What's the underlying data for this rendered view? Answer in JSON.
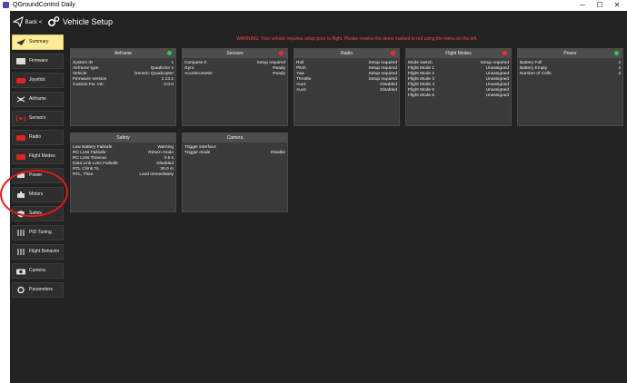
{
  "titlebar": {
    "title": "QGroundControl Daily",
    "minimize": "─",
    "maximize": "☐",
    "close": "✕"
  },
  "toolbar": {
    "back_label": "Back",
    "back_chevron": "<",
    "title": "Vehicle Setup"
  },
  "warning": "WARNING: Your vehicle requires setup prior to flight. Please resolve the items marked in red using the menu on the left.",
  "colors": {
    "active_bg": "#ffec99",
    "ok_dot": "#2ecc40",
    "error_dot": "#ff2a2a",
    "warning_text": "#ff4444",
    "annotation": "#e01919"
  },
  "sidebar": {
    "items": [
      {
        "label": "Summary",
        "icon": "paper-plane-icon"
      },
      {
        "label": "Firmware",
        "icon": "firmware-chip-icon"
      },
      {
        "label": "Joystick",
        "icon": "joystick-icon"
      },
      {
        "label": "Airframe",
        "icon": "airframe-icon"
      },
      {
        "label": "Sensors",
        "icon": "sensors-icon"
      },
      {
        "label": "Radio",
        "icon": "radio-icon"
      },
      {
        "label": "Flight Modes",
        "icon": "flight-modes-icon"
      },
      {
        "label": "Power",
        "icon": "power-icon"
      },
      {
        "label": "Motors",
        "icon": "motors-icon"
      },
      {
        "label": "Safety",
        "icon": "safety-icon"
      },
      {
        "label": "PID Tuning",
        "icon": "pid-tuning-icon"
      },
      {
        "label": "Flight Behavior",
        "icon": "flight-behavior-icon"
      },
      {
        "label": "Camera",
        "icon": "camera-icon"
      },
      {
        "label": "Parameters",
        "icon": "parameters-icon"
      }
    ]
  },
  "cards": {
    "airframe": {
      "title": "Airframe",
      "status": "ok",
      "rows": [
        {
          "k": "System ID",
          "v": "1"
        },
        {
          "k": "Airframe type",
          "v": "Quadrotor x"
        },
        {
          "k": "Vehicle",
          "v": "Generic Quadcopter"
        },
        {
          "k": "Firmware Version",
          "v": "1.13.1"
        },
        {
          "k": "Custom Fw. Ver.",
          "v": "0.0.0"
        }
      ]
    },
    "sensors": {
      "title": "Sensors",
      "status": "error",
      "rows": [
        {
          "k": "Compass 0",
          "v": "Setup required"
        },
        {
          "k": "Gyro",
          "v": "Ready"
        },
        {
          "k": "Accelerometer",
          "v": "Ready"
        }
      ]
    },
    "radio": {
      "title": "Radio",
      "status": "error",
      "rows": [
        {
          "k": "Roll",
          "v": "Setup required"
        },
        {
          "k": "Pitch",
          "v": "Setup required"
        },
        {
          "k": "Yaw",
          "v": "Setup required"
        },
        {
          "k": "Throttle",
          "v": "Setup required"
        },
        {
          "k": "Aux1",
          "v": "Disabled"
        },
        {
          "k": "Aux2",
          "v": "Disabled"
        }
      ]
    },
    "flightmodes": {
      "title": "Flight Modes",
      "status": "error",
      "rows": [
        {
          "k": "Mode switch",
          "v": "Setup required"
        },
        {
          "k": "Flight Mode 1",
          "v": "Unassigned"
        },
        {
          "k": "Flight Mode 2",
          "v": "Unassigned"
        },
        {
          "k": "Flight Mode 3",
          "v": "Unassigned"
        },
        {
          "k": "Flight Mode 4",
          "v": "Unassigned"
        },
        {
          "k": "Flight Mode 5",
          "v": "Unassigned"
        },
        {
          "k": "Flight Mode 6",
          "v": "Unassigned"
        }
      ]
    },
    "power": {
      "title": "Power",
      "status": "ok",
      "rows": [
        {
          "k": "Battery Full",
          "v": "4"
        },
        {
          "k": "Battery Empty",
          "v": "4"
        },
        {
          "k": "Number of Cells",
          "v": "3"
        }
      ]
    },
    "safety": {
      "title": "Safety",
      "status": "none",
      "rows": [
        {
          "k": "Low Battery Failsafe",
          "v": "Warning"
        },
        {
          "k": "RC Loss Failsafe",
          "v": "Return mode"
        },
        {
          "k": "RC Loss Timeout",
          "v": "0.5 s"
        },
        {
          "k": "Data Link Loss Failsafe",
          "v": "Disabled"
        },
        {
          "k": "RTL Climb To",
          "v": "30.0 m"
        },
        {
          "k": "RTL, Then",
          "v": "Land immediately"
        }
      ]
    },
    "camera": {
      "title": "Camera",
      "status": "none",
      "rows": [
        {
          "k": "Trigger interface",
          "v": ""
        },
        {
          "k": "Trigger mode",
          "v": "Disable"
        }
      ]
    }
  }
}
